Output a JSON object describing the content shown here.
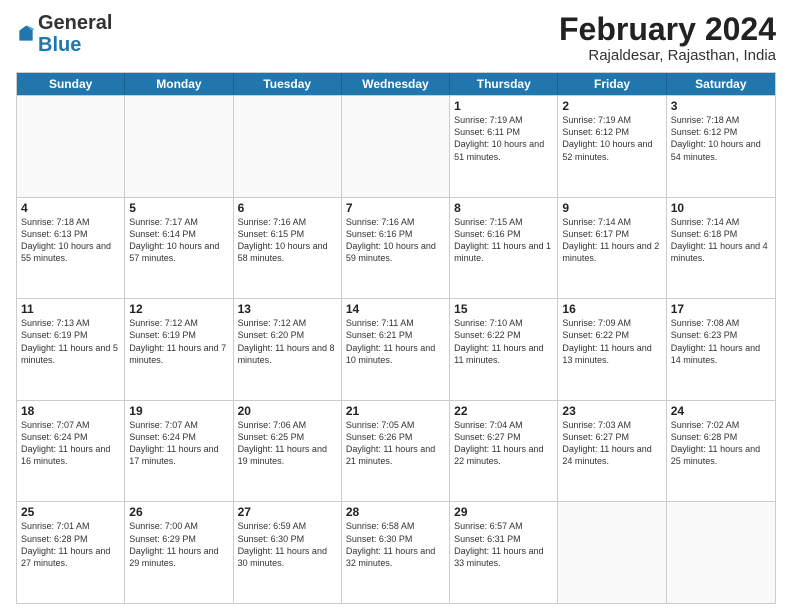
{
  "header": {
    "logo_general": "General",
    "logo_blue": "Blue",
    "month_year": "February 2024",
    "location": "Rajaldesar, Rajasthan, India"
  },
  "calendar": {
    "days_of_week": [
      "Sunday",
      "Monday",
      "Tuesday",
      "Wednesday",
      "Thursday",
      "Friday",
      "Saturday"
    ],
    "weeks": [
      [
        {
          "day": "",
          "info": ""
        },
        {
          "day": "",
          "info": ""
        },
        {
          "day": "",
          "info": ""
        },
        {
          "day": "",
          "info": ""
        },
        {
          "day": "1",
          "info": "Sunrise: 7:19 AM\nSunset: 6:11 PM\nDaylight: 10 hours and 51 minutes."
        },
        {
          "day": "2",
          "info": "Sunrise: 7:19 AM\nSunset: 6:12 PM\nDaylight: 10 hours and 52 minutes."
        },
        {
          "day": "3",
          "info": "Sunrise: 7:18 AM\nSunset: 6:12 PM\nDaylight: 10 hours and 54 minutes."
        }
      ],
      [
        {
          "day": "4",
          "info": "Sunrise: 7:18 AM\nSunset: 6:13 PM\nDaylight: 10 hours and 55 minutes."
        },
        {
          "day": "5",
          "info": "Sunrise: 7:17 AM\nSunset: 6:14 PM\nDaylight: 10 hours and 57 minutes."
        },
        {
          "day": "6",
          "info": "Sunrise: 7:16 AM\nSunset: 6:15 PM\nDaylight: 10 hours and 58 minutes."
        },
        {
          "day": "7",
          "info": "Sunrise: 7:16 AM\nSunset: 6:16 PM\nDaylight: 10 hours and 59 minutes."
        },
        {
          "day": "8",
          "info": "Sunrise: 7:15 AM\nSunset: 6:16 PM\nDaylight: 11 hours and 1 minute."
        },
        {
          "day": "9",
          "info": "Sunrise: 7:14 AM\nSunset: 6:17 PM\nDaylight: 11 hours and 2 minutes."
        },
        {
          "day": "10",
          "info": "Sunrise: 7:14 AM\nSunset: 6:18 PM\nDaylight: 11 hours and 4 minutes."
        }
      ],
      [
        {
          "day": "11",
          "info": "Sunrise: 7:13 AM\nSunset: 6:19 PM\nDaylight: 11 hours and 5 minutes."
        },
        {
          "day": "12",
          "info": "Sunrise: 7:12 AM\nSunset: 6:19 PM\nDaylight: 11 hours and 7 minutes."
        },
        {
          "day": "13",
          "info": "Sunrise: 7:12 AM\nSunset: 6:20 PM\nDaylight: 11 hours and 8 minutes."
        },
        {
          "day": "14",
          "info": "Sunrise: 7:11 AM\nSunset: 6:21 PM\nDaylight: 11 hours and 10 minutes."
        },
        {
          "day": "15",
          "info": "Sunrise: 7:10 AM\nSunset: 6:22 PM\nDaylight: 11 hours and 11 minutes."
        },
        {
          "day": "16",
          "info": "Sunrise: 7:09 AM\nSunset: 6:22 PM\nDaylight: 11 hours and 13 minutes."
        },
        {
          "day": "17",
          "info": "Sunrise: 7:08 AM\nSunset: 6:23 PM\nDaylight: 11 hours and 14 minutes."
        }
      ],
      [
        {
          "day": "18",
          "info": "Sunrise: 7:07 AM\nSunset: 6:24 PM\nDaylight: 11 hours and 16 minutes."
        },
        {
          "day": "19",
          "info": "Sunrise: 7:07 AM\nSunset: 6:24 PM\nDaylight: 11 hours and 17 minutes."
        },
        {
          "day": "20",
          "info": "Sunrise: 7:06 AM\nSunset: 6:25 PM\nDaylight: 11 hours and 19 minutes."
        },
        {
          "day": "21",
          "info": "Sunrise: 7:05 AM\nSunset: 6:26 PM\nDaylight: 11 hours and 21 minutes."
        },
        {
          "day": "22",
          "info": "Sunrise: 7:04 AM\nSunset: 6:27 PM\nDaylight: 11 hours and 22 minutes."
        },
        {
          "day": "23",
          "info": "Sunrise: 7:03 AM\nSunset: 6:27 PM\nDaylight: 11 hours and 24 minutes."
        },
        {
          "day": "24",
          "info": "Sunrise: 7:02 AM\nSunset: 6:28 PM\nDaylight: 11 hours and 25 minutes."
        }
      ],
      [
        {
          "day": "25",
          "info": "Sunrise: 7:01 AM\nSunset: 6:28 PM\nDaylight: 11 hours and 27 minutes."
        },
        {
          "day": "26",
          "info": "Sunrise: 7:00 AM\nSunset: 6:29 PM\nDaylight: 11 hours and 29 minutes."
        },
        {
          "day": "27",
          "info": "Sunrise: 6:59 AM\nSunset: 6:30 PM\nDaylight: 11 hours and 30 minutes."
        },
        {
          "day": "28",
          "info": "Sunrise: 6:58 AM\nSunset: 6:30 PM\nDaylight: 11 hours and 32 minutes."
        },
        {
          "day": "29",
          "info": "Sunrise: 6:57 AM\nSunset: 6:31 PM\nDaylight: 11 hours and 33 minutes."
        },
        {
          "day": "",
          "info": ""
        },
        {
          "day": "",
          "info": ""
        }
      ]
    ]
  }
}
